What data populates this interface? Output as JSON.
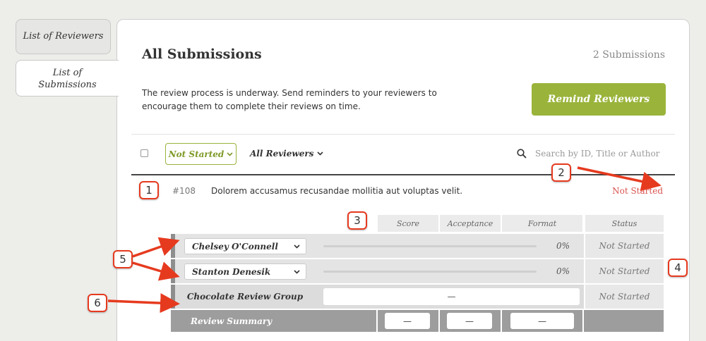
{
  "sidebar": {
    "tabs": [
      {
        "label": "List of Reviewers"
      },
      {
        "label": "List of\nSubmissions",
        "line1": "List of",
        "line2": "Submissions"
      }
    ]
  },
  "header": {
    "title": "All Submissions",
    "count": "2 Submissions",
    "description": "The review process is underway. Send reminders to your reviewers to encourage them to complete their reviews on time.",
    "remind_button": "Remind Reviewers"
  },
  "filters": {
    "status_filter": "Not Started",
    "reviewer_filter": "All Reviewers",
    "search_placeholder": "Search by ID, Title or Author"
  },
  "submission": {
    "id": "#108",
    "title": "Dolorem accusamus recusandae mollitia aut voluptas velit.",
    "status": "Not Started"
  },
  "review_table": {
    "columns": [
      "Score",
      "Acceptance",
      "Format",
      "Status"
    ],
    "reviewers": [
      {
        "name": "Chelsey O'Connell",
        "progress_text": "0%",
        "progress": 0,
        "status": "Not Started"
      },
      {
        "name": "Stanton Denesik",
        "progress_text": "0%",
        "progress": 0,
        "status": "Not Started"
      }
    ],
    "group": {
      "name": "Chocolate Review Group",
      "value": "—",
      "status": "Not Started"
    },
    "summary": {
      "label": "Review Summary",
      "score": "—",
      "acceptance": "—",
      "format": "—"
    }
  },
  "annotations": [
    "1",
    "2",
    "3",
    "4",
    "5",
    "6"
  ],
  "colors": {
    "accent": "#9ab43b",
    "status_red": "#d9534f",
    "annotation_red": "#e63a1f"
  }
}
